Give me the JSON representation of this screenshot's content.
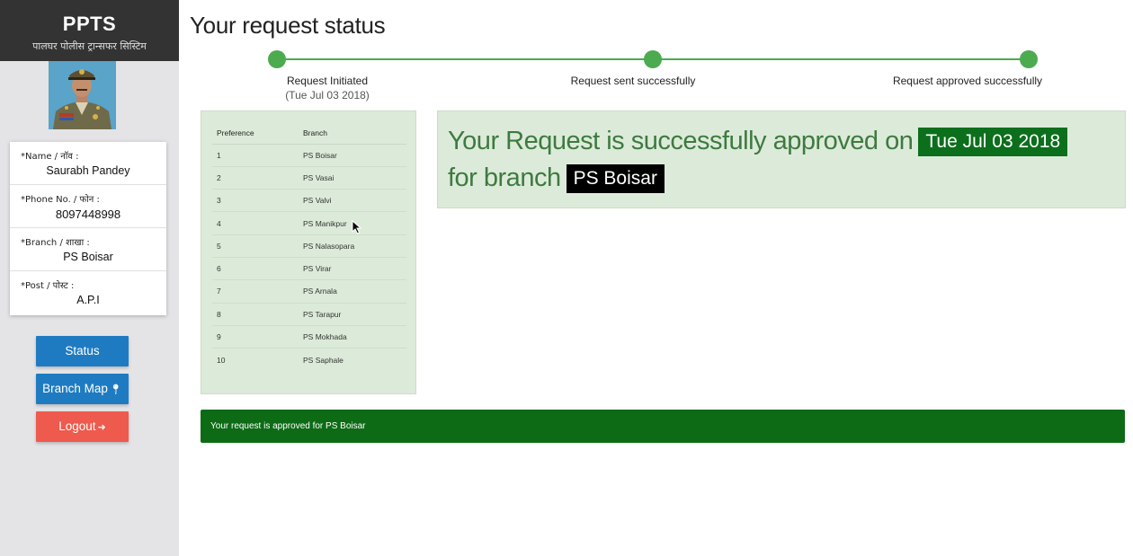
{
  "sidebar": {
    "brand_title": "PPTS",
    "brand_subtitle": "पालघर पोलीस ट्रान्सफर सिस्टिम",
    "profile": {
      "name_label": "*Name / नाॅव :",
      "name_value": "Saurabh Pandey",
      "phone_label": "*Phone No. / फोन :",
      "phone_value": "8097448998",
      "branch_label": "*Branch / शाखा :",
      "branch_value": "PS Boisar",
      "post_label": "*Post / पोस्ट :",
      "post_value": "A.P.I"
    },
    "buttons": {
      "status": "Status",
      "branch_map": "Branch Map",
      "logout": "Logout"
    }
  },
  "main": {
    "title": "Your request status",
    "steps": [
      {
        "label": "Request Initiated",
        "sub": "(Tue Jul 03 2018)"
      },
      {
        "label": "Request sent successfully"
      },
      {
        "label": "Request approved successfully"
      }
    ],
    "preferences": {
      "headers": [
        "Preference",
        "Branch"
      ],
      "rows": [
        [
          "1",
          "PS Boisar"
        ],
        [
          "2",
          "PS Vasai"
        ],
        [
          "3",
          "PS Valvi"
        ],
        [
          "4",
          "PS Manikpur"
        ],
        [
          "5",
          "PS Nalasopara"
        ],
        [
          "6",
          "PS Virar"
        ],
        [
          "7",
          "PS Arnala"
        ],
        [
          "8",
          "PS Tarapur"
        ],
        [
          "9",
          "PS Mokhada"
        ],
        [
          "10",
          "PS Saphale"
        ]
      ]
    },
    "approval": {
      "text_part1": "Your Request is successfully approved on",
      "date": "Tue Jul 03 2018",
      "text_part2": "for branch",
      "branch": "PS Boisar"
    },
    "banner": "Your request is approved for PS Boisar"
  },
  "colors": {
    "sidebar_bg": "#e4e3e6",
    "brand_bg": "#333333",
    "primary_button": "#1f7bc1",
    "logout_button": "#ee5a4d",
    "step_green": "#4caa4f",
    "panel_green": "#dcebd9",
    "banner_green": "#0d6b16",
    "approved_text": "#3e7a40"
  },
  "icons": {
    "branch_map": "map-marker-icon",
    "logout": "sign-out-icon",
    "cursor": "mouse-pointer"
  }
}
